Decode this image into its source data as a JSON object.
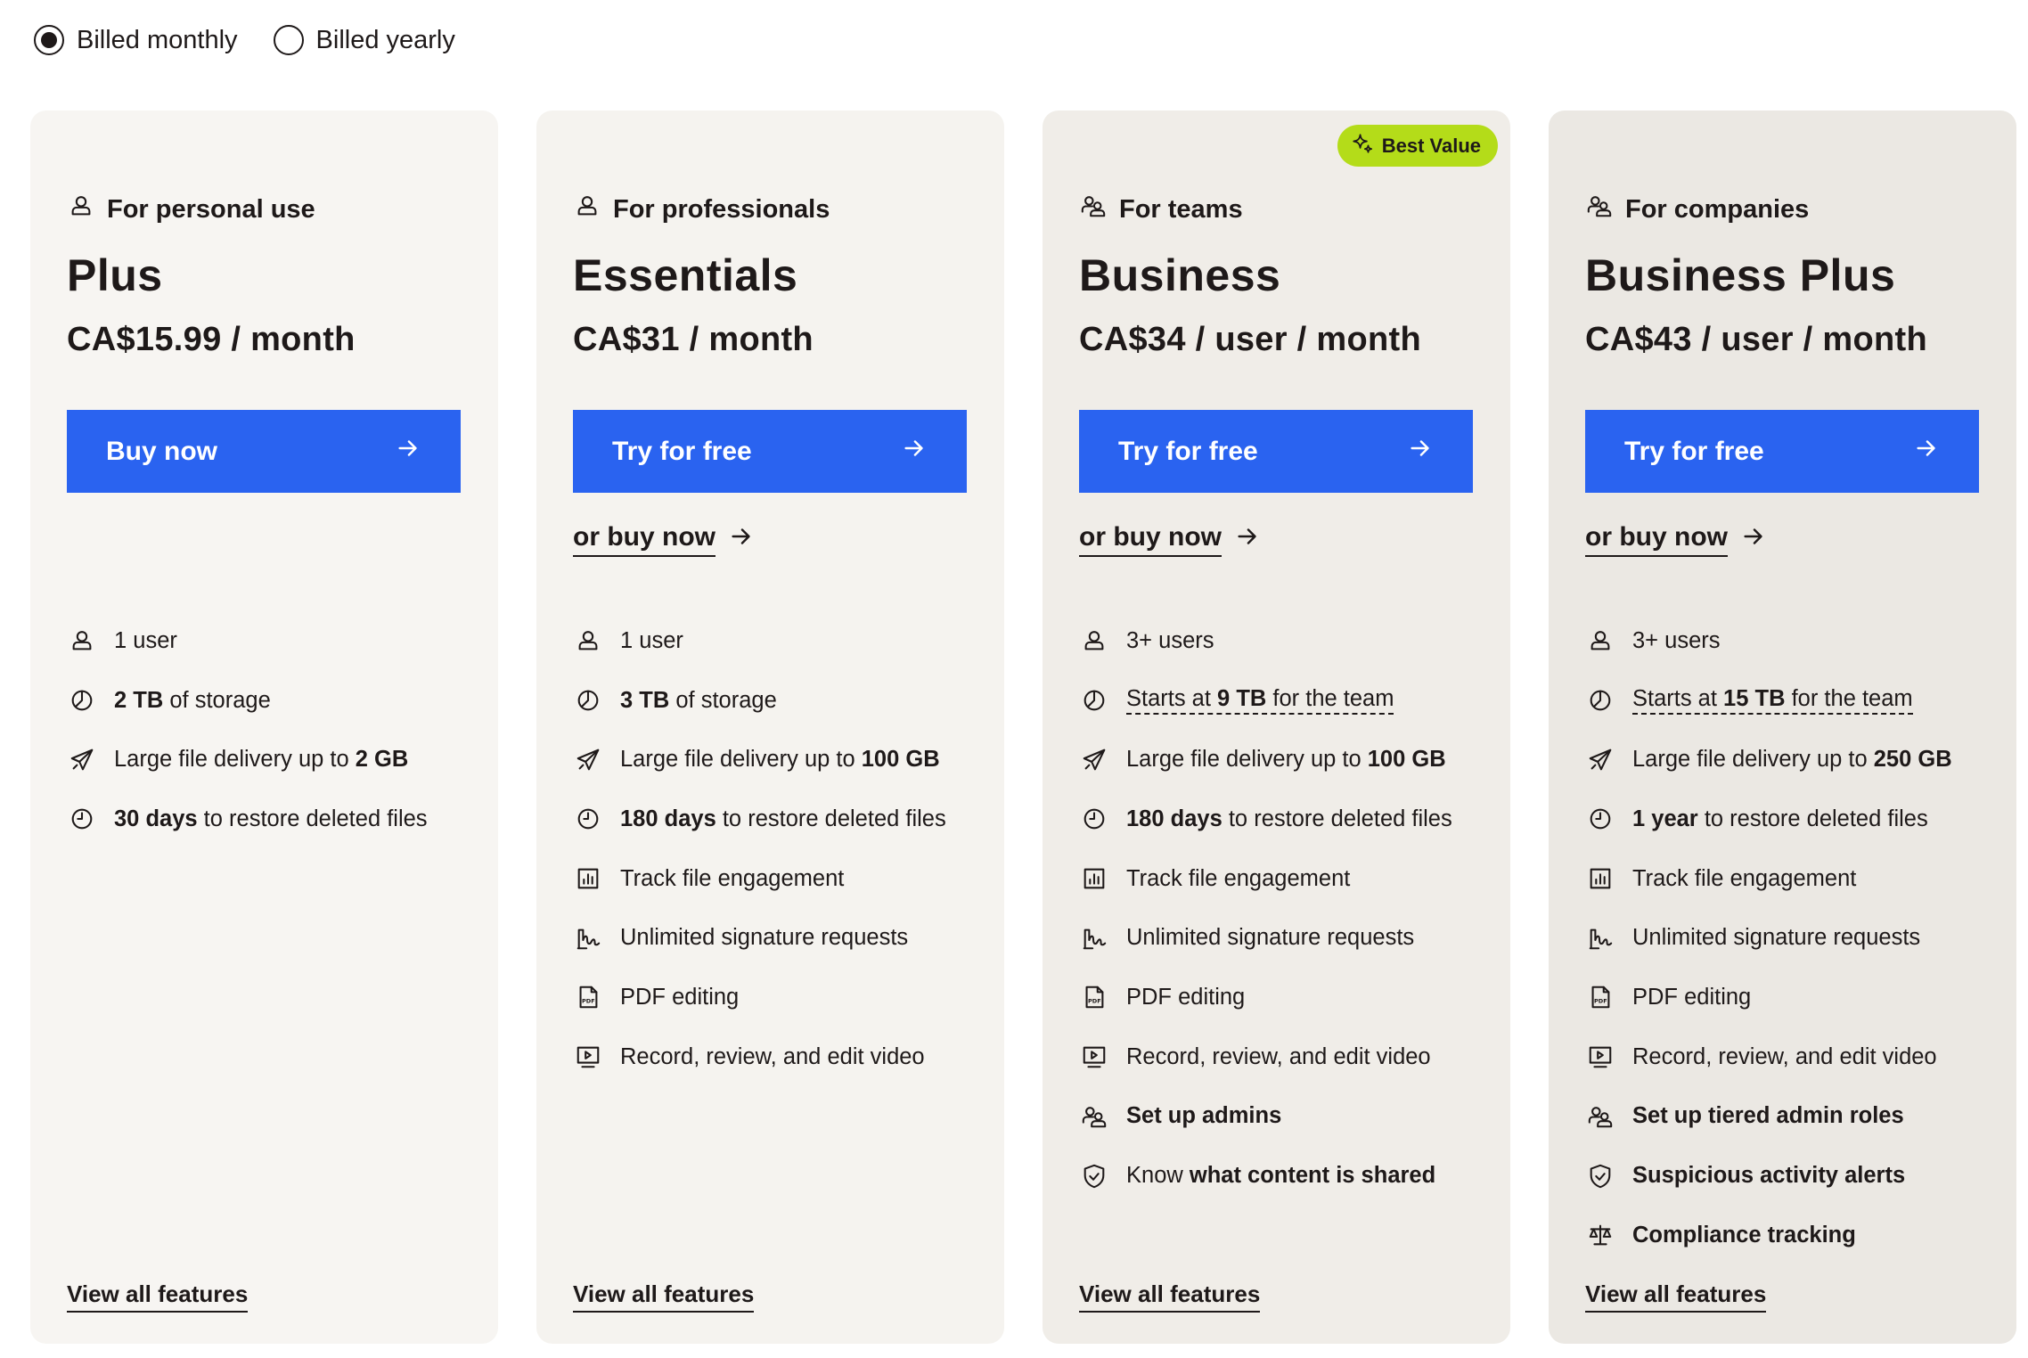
{
  "billing": {
    "options": [
      {
        "label": "Billed monthly",
        "selected": true
      },
      {
        "label": "Billed yearly",
        "selected": false
      }
    ]
  },
  "plans": [
    {
      "bg": "#f7f5f2",
      "audience": "For personal use",
      "audience_icon": "person-icon",
      "name": "Plus",
      "price": "CA$15.99 / month",
      "cta": "Buy now",
      "buy_link": "",
      "badge": "",
      "features": [
        {
          "icon": "person-icon",
          "parts": [
            {
              "t": "1 user"
            }
          ]
        },
        {
          "icon": "storage-pie-icon",
          "parts": [
            {
              "t": "2 TB",
              "b": true
            },
            {
              "t": " of storage"
            }
          ]
        },
        {
          "icon": "paper-plane-icon",
          "parts": [
            {
              "t": "Large file delivery up to "
            },
            {
              "t": "2 GB",
              "b": true
            }
          ]
        },
        {
          "icon": "clock-icon",
          "parts": [
            {
              "t": "30 days",
              "b": true
            },
            {
              "t": " to restore deleted files"
            }
          ]
        }
      ],
      "view_all": "View all features"
    },
    {
      "bg": "#f5f3ef",
      "audience": "For professionals",
      "audience_icon": "person-icon",
      "name": "Essentials",
      "price": "CA$31 / month",
      "cta": "Try for free",
      "buy_link": "or buy now",
      "badge": "",
      "features": [
        {
          "icon": "person-icon",
          "parts": [
            {
              "t": "1 user"
            }
          ]
        },
        {
          "icon": "storage-pie-icon",
          "parts": [
            {
              "t": "3 TB",
              "b": true
            },
            {
              "t": " of storage"
            }
          ]
        },
        {
          "icon": "paper-plane-icon",
          "parts": [
            {
              "t": "Large file delivery up to "
            },
            {
              "t": "100 GB",
              "b": true
            }
          ]
        },
        {
          "icon": "clock-icon",
          "parts": [
            {
              "t": "180 days",
              "b": true
            },
            {
              "t": " to restore deleted files"
            }
          ]
        },
        {
          "icon": "bar-chart-icon",
          "parts": [
            {
              "t": "Track file engagement"
            }
          ]
        },
        {
          "icon": "signature-icon",
          "parts": [
            {
              "t": "Unlimited signature requests"
            }
          ]
        },
        {
          "icon": "pdf-icon",
          "parts": [
            {
              "t": "PDF editing"
            }
          ]
        },
        {
          "icon": "video-icon",
          "parts": [
            {
              "t": "Record, review, and edit video"
            }
          ]
        }
      ],
      "view_all": "View all features"
    },
    {
      "bg": "#f0ede8",
      "audience": "For teams",
      "audience_icon": "team-icon",
      "name": "Business",
      "price": "CA$34 / user / month",
      "cta": "Try for free",
      "buy_link": "or buy now",
      "badge": "Best Value",
      "features": [
        {
          "icon": "person-icon",
          "parts": [
            {
              "t": "3+ users"
            }
          ]
        },
        {
          "icon": "storage-pie-icon",
          "dashed": true,
          "parts": [
            {
              "t": "Starts at "
            },
            {
              "t": "9 TB",
              "b": true
            },
            {
              "t": " for the team"
            }
          ]
        },
        {
          "icon": "paper-plane-icon",
          "parts": [
            {
              "t": "Large file delivery up to "
            },
            {
              "t": "100 GB",
              "b": true
            }
          ]
        },
        {
          "icon": "clock-icon",
          "parts": [
            {
              "t": "180 days",
              "b": true
            },
            {
              "t": " to restore deleted files"
            }
          ]
        },
        {
          "icon": "bar-chart-icon",
          "parts": [
            {
              "t": "Track file engagement"
            }
          ]
        },
        {
          "icon": "signature-icon",
          "parts": [
            {
              "t": "Unlimited signature requests"
            }
          ]
        },
        {
          "icon": "pdf-icon",
          "parts": [
            {
              "t": "PDF editing"
            }
          ]
        },
        {
          "icon": "video-icon",
          "parts": [
            {
              "t": "Record, review, and edit video"
            }
          ]
        },
        {
          "icon": "team-icon",
          "parts": [
            {
              "t": "Set up admins",
              "b": true
            }
          ]
        },
        {
          "icon": "shield-icon",
          "parts": [
            {
              "t": "Know "
            },
            {
              "t": "what content is shared",
              "b": true
            }
          ]
        }
      ],
      "view_all": "View all features"
    },
    {
      "bg": "#ebe8e3",
      "audience": "For companies",
      "audience_icon": "team-icon",
      "name": "Business Plus",
      "price": "CA$43 / user / month",
      "cta": "Try for free",
      "buy_link": "or buy now",
      "badge": "",
      "features": [
        {
          "icon": "person-icon",
          "parts": [
            {
              "t": "3+ users"
            }
          ]
        },
        {
          "icon": "storage-pie-icon",
          "dashed": true,
          "parts": [
            {
              "t": "Starts at "
            },
            {
              "t": "15 TB",
              "b": true
            },
            {
              "t": " for the team"
            }
          ]
        },
        {
          "icon": "paper-plane-icon",
          "parts": [
            {
              "t": "Large file delivery up to "
            },
            {
              "t": "250 GB",
              "b": true
            }
          ]
        },
        {
          "icon": "clock-icon",
          "parts": [
            {
              "t": "1 year",
              "b": true
            },
            {
              "t": " to restore deleted files"
            }
          ]
        },
        {
          "icon": "bar-chart-icon",
          "parts": [
            {
              "t": "Track file engagement"
            }
          ]
        },
        {
          "icon": "signature-icon",
          "parts": [
            {
              "t": "Unlimited signature requests"
            }
          ]
        },
        {
          "icon": "pdf-icon",
          "parts": [
            {
              "t": "PDF editing"
            }
          ]
        },
        {
          "icon": "video-icon",
          "parts": [
            {
              "t": "Record, review, and edit video"
            }
          ]
        },
        {
          "icon": "team-icon",
          "parts": [
            {
              "t": "Set up tiered admin roles",
              "b": true
            }
          ]
        },
        {
          "icon": "shield-icon",
          "parts": [
            {
              "t": "Suspicious activity alerts",
              "b": true
            }
          ]
        },
        {
          "icon": "scale-icon",
          "parts": [
            {
              "t": "Compliance tracking",
              "b": true
            }
          ]
        }
      ],
      "view_all": "View all features"
    }
  ],
  "colors": {
    "accent": "#2a63f0",
    "badge": "#b4dc19",
    "text": "#1e1919"
  }
}
